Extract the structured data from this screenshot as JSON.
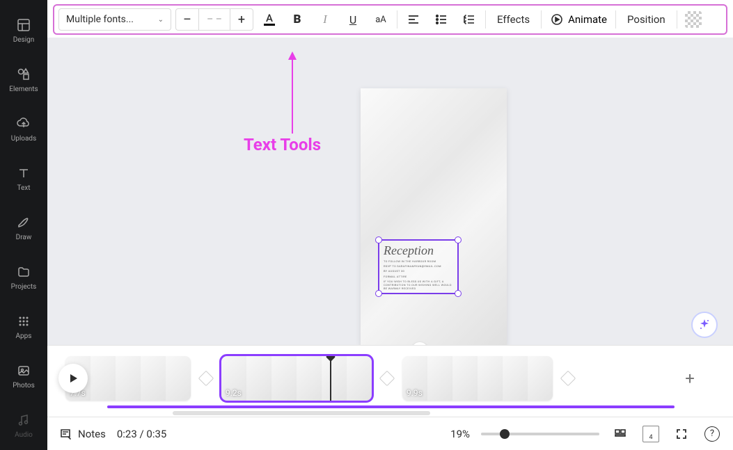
{
  "nav": {
    "items": [
      {
        "label": "Design",
        "icon": "layout"
      },
      {
        "label": "Elements",
        "icon": "shapes"
      },
      {
        "label": "Uploads",
        "icon": "cloud"
      },
      {
        "label": "Text",
        "icon": "text"
      },
      {
        "label": "Draw",
        "icon": "pencil"
      },
      {
        "label": "Projects",
        "icon": "folder"
      },
      {
        "label": "Apps",
        "icon": "grid"
      },
      {
        "label": "Photos",
        "icon": "photo"
      },
      {
        "label": "Audio",
        "icon": "music"
      }
    ]
  },
  "toolbar": {
    "font_name": "Multiple fonts...",
    "font_size": "– –",
    "minus": "–",
    "plus": "+",
    "effects": "Effects",
    "animate": "Animate",
    "position": "Position",
    "text_color": "#000000",
    "underline_accent": "#a259ff"
  },
  "annotation": {
    "label": "Text Tools"
  },
  "selected_text": {
    "title": "Reception",
    "line1": "To follow in the Harbour Room",
    "line2": "RSVP to sarafina&ryan@email.com",
    "line3": "by August 30",
    "line4": "Formal attire",
    "line5": "If you wish to bless us with a gift, a contribution to our wishing well would be warmly received"
  },
  "timeline": {
    "clips": [
      {
        "duration": "7.7s",
        "frames": 5,
        "active": false
      },
      {
        "duration": "9.2s",
        "frames": 6,
        "active": true
      },
      {
        "duration": "9.9s",
        "frames": 6,
        "active": false
      }
    ],
    "playhead_pct": 72
  },
  "footer": {
    "notes": "Notes",
    "time": "0:23 / 0:35",
    "zoom": "19%",
    "zoom_pct": 16,
    "page_indicator": "4"
  }
}
